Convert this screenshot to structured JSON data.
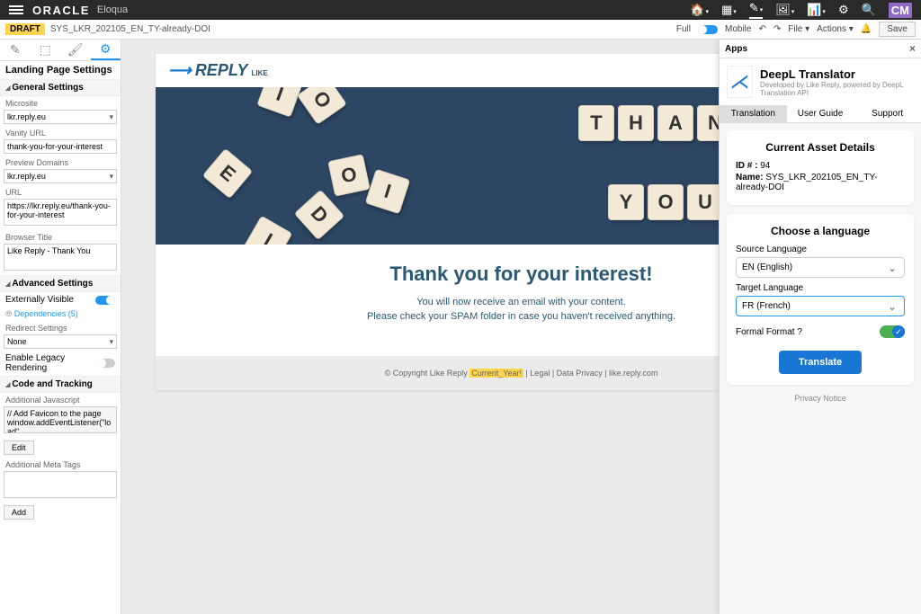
{
  "header": {
    "brand": "ORACLE",
    "product": "Eloqua",
    "user_badge": "CM"
  },
  "sub_header": {
    "draft_badge": "DRAFT",
    "asset_name": "SYS_LKR_202105_EN_TY-already-DOI",
    "full_label": "Full",
    "mobile_label": "Mobile",
    "file_label": "File ▾",
    "actions_label": "Actions ▾",
    "save_label": "Save"
  },
  "sidebar": {
    "title": "Landing Page Settings",
    "sections": {
      "general": "General Settings",
      "advanced": "Advanced Settings",
      "code": "Code and Tracking"
    },
    "microsite_label": "Microsite",
    "microsite_value": "lkr.reply.eu",
    "vanity_label": "Vanity URL",
    "vanity_value": "thank-you-for-your-interest",
    "preview_label": "Preview Domains",
    "preview_value": "lkr.reply.eu",
    "url_label": "URL",
    "url_value": "https://lkr.reply.eu/thank-you-for-your-interest",
    "browser_title_label": "Browser Title",
    "browser_title_value": "Like Reply - Thank You",
    "ext_visible_label": "Externally Visible",
    "dependencies_label": "Dependencies (5)",
    "redirect_label": "Redirect Settings",
    "redirect_value": "None",
    "legacy_label": "Enable Legacy Rendering",
    "js_label": "Additional Javascript",
    "js_value": "// Add Favicon to the page\nwindow.addEventListener(\"load\",\nfunction() {",
    "edit_btn": "Edit",
    "meta_label": "Additional Meta Tags",
    "add_btn": "Add"
  },
  "landing_page": {
    "logo_main": "REPLY",
    "logo_sub": "LIKE",
    "tiles": [
      "I",
      "O",
      "O",
      "I",
      "D",
      "T",
      "H",
      "A",
      "N",
      "Y",
      "O",
      "U",
      "E",
      "I"
    ],
    "heading": "Thank you for your interest!",
    "line1": "You will now receive an email with your content.",
    "line2": "Please check your SPAM folder in case you haven't received anything.",
    "footer_copy": "© Copyright Like Reply ",
    "footer_year": "Current_Year!",
    "footer_links": "  |  Legal  |  Data Privacy  |  like.reply.com"
  },
  "right_panel": {
    "title": "Apps",
    "app_name": "DeepL Translator",
    "app_sub": "Developed by Like Reply, powered by DeepL Translation API",
    "tabs": {
      "translation": "Translation",
      "guide": "User Guide",
      "support": "Support"
    },
    "card1_title": "Current Asset Details",
    "id_label": "ID # :",
    "id_value": "94",
    "name_label": "Name:",
    "name_value": "SYS_LKR_202105_EN_TY-already-DOI",
    "card2_title": "Choose a language",
    "src_label": "Source Language",
    "src_value": "EN (English)",
    "tgt_label": "Target Language",
    "tgt_value": "FR (French)",
    "formal_label": "Formal Format ?",
    "translate_btn": "Translate",
    "privacy": "Privacy Notice"
  }
}
